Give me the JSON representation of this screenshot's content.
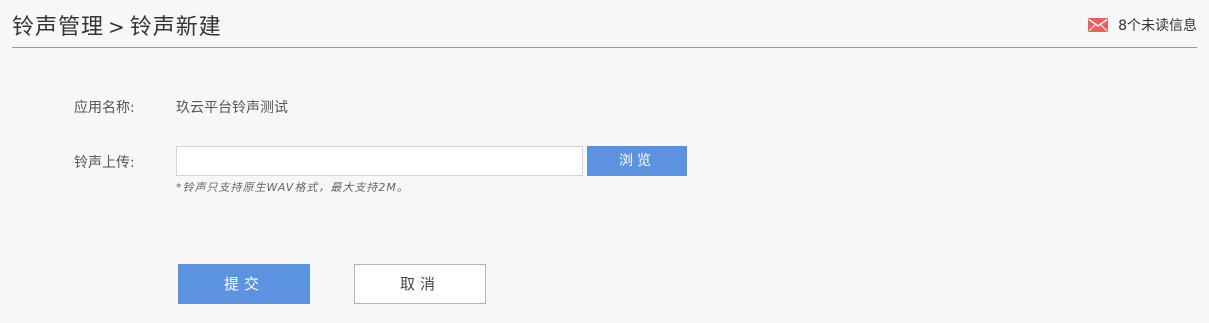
{
  "header": {
    "breadcrumb_parent": "铃声管理",
    "breadcrumb_separator": ">",
    "breadcrumb_current": "铃声新建",
    "messages_text": "8个未读信息",
    "mail_icon": "mail-icon",
    "mail_icon_color": "#f0605a"
  },
  "form": {
    "app_name_label": "应用名称:",
    "app_name_value": "玖云平台铃声测试",
    "ringtone_upload_label": "铃声上传:",
    "file_input_value": "",
    "browse_label": "浏览",
    "hint": "*铃声只支持原生WAV格式，最大支持2M。"
  },
  "actions": {
    "submit_label": "提交",
    "cancel_label": "取消"
  },
  "colors": {
    "accent": "#5b93e0",
    "background": "#f7f7f7"
  }
}
